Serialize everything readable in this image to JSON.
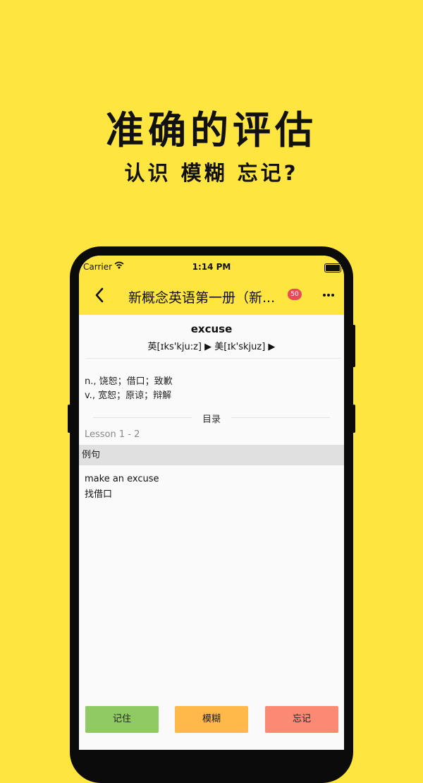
{
  "promo": {
    "title": "准确的评估",
    "subtitle": "认识 模糊 忘记?"
  },
  "status_bar": {
    "carrier": "Carrier",
    "time": "1:14 PM"
  },
  "nav": {
    "title": "新概念英语第一册（新...",
    "badge": "50",
    "back_icon": "chevron-left-icon",
    "more_icon": "ellipsis-icon"
  },
  "word": {
    "term": "excuse",
    "phonetic": "英[ɪks'kju:z] ▶ 美[ɪk'skjuz] ▶"
  },
  "definitions": [
    "n., 饶恕；借口；致歉",
    "v., 宽恕；原谅；辩解"
  ],
  "directory": {
    "label": "目录",
    "lesson": "Lesson 1 - 2"
  },
  "examples": {
    "header": "例句",
    "english": "make an excuse",
    "chinese": "找借口"
  },
  "buttons": {
    "remember": "记住",
    "fuzzy": "模糊",
    "forget": "忘记"
  },
  "colors": {
    "background": "#FFE53F",
    "remember": "#8FCB62",
    "fuzzy": "#FFB84A",
    "forget": "#FA8A74",
    "badge": "#E84A5A"
  }
}
